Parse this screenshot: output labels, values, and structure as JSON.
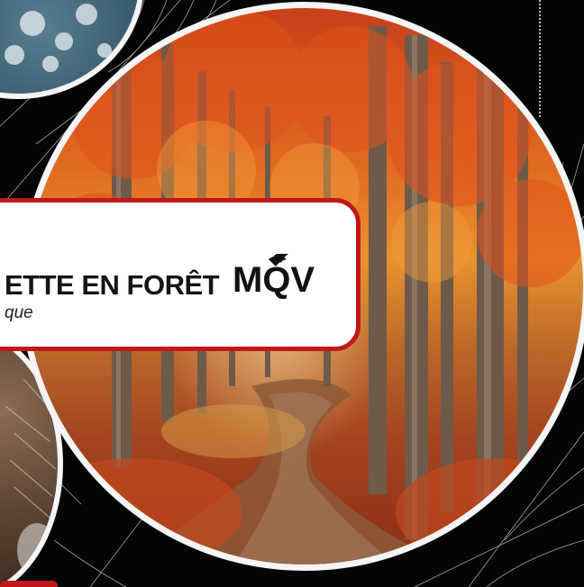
{
  "banner": {
    "title": "ETTE EN FORÊT",
    "subtitle": "que"
  },
  "logo": {
    "text": "MQV",
    "icon": "leaf-q-logo-icon"
  },
  "colors": {
    "accent_red": "#c01818",
    "frame_white": "#f5f5f5",
    "background": "#000000"
  },
  "images": {
    "main": "autumn forest path",
    "top_left": "snowy landscape",
    "left": "hedgehog fur"
  }
}
